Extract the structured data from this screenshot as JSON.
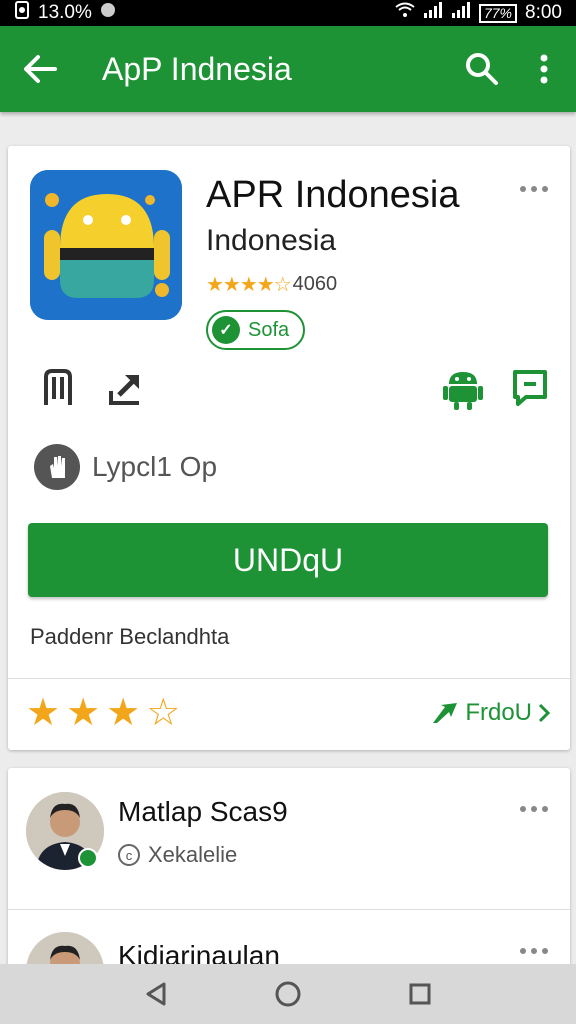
{
  "status_bar": {
    "left_text": "13.0%",
    "right_text": "8:00",
    "battery_text": "77%"
  },
  "app_bar": {
    "title": "ApP Indnesia"
  },
  "app": {
    "name": "APR Indonesia",
    "developer": "Indonesia",
    "rating_stars": "★★★★☆",
    "rating_count": "4060",
    "badge_label": "Sofa",
    "install_label": "Lypcl1 Op",
    "download_label": "UNDqU",
    "description": "Paddenr Beclandhta"
  },
  "rating": {
    "stars_filled": 3,
    "stars_total": 4,
    "link_label": "FrdoU"
  },
  "reviews": [
    {
      "name": "Matlap Scas9",
      "subtitle": "Xekalelie"
    },
    {
      "name": "Kidiarinaulan"
    }
  ],
  "colors": {
    "primary": "#1e9336",
    "star": "#f3a619",
    "app_icon_bg": "#1f72c9"
  }
}
